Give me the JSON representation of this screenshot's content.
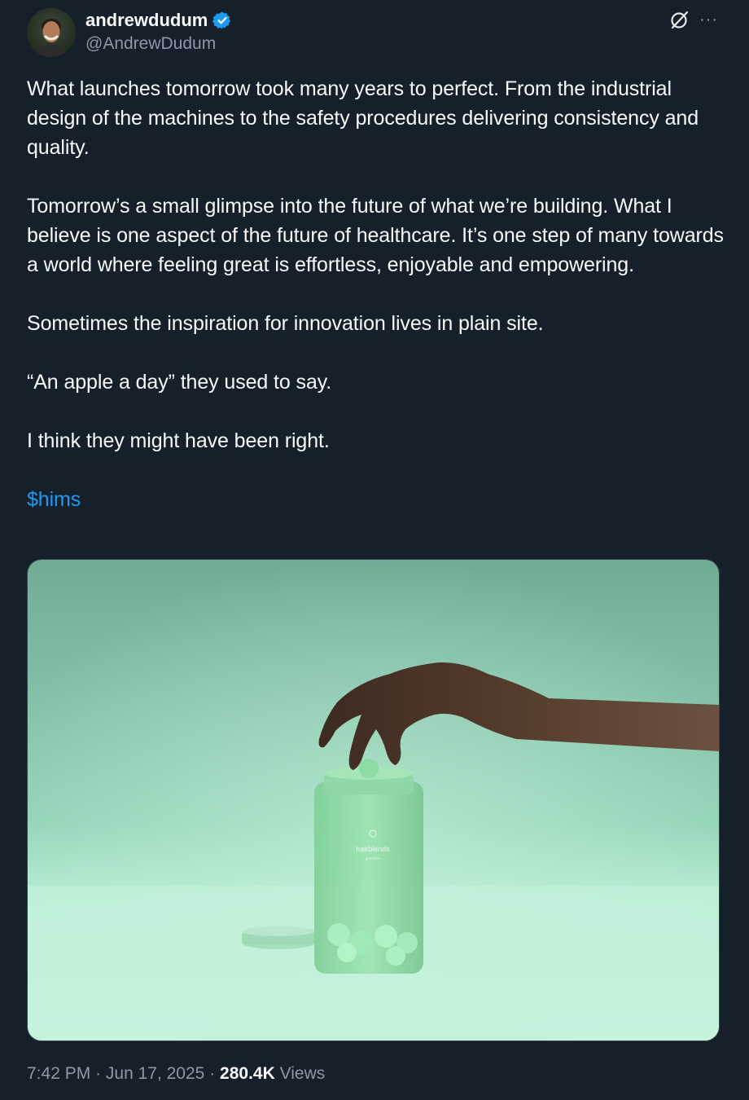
{
  "author": {
    "display_name": "andrewdudum",
    "handle": "@AndrewDudum",
    "verified": true,
    "avatar_icon": "profile-photo"
  },
  "actions": {
    "grok_icon": "grok-icon",
    "more_label": "···"
  },
  "tweet": {
    "paragraphs": [
      "What launches tomorrow took many years to perfect. From the industrial design of the machines to the safety procedures delivering consistency and quality.",
      "Tomorrow’s a small glimpse into the future of what we’re building. What I believe is one aspect of the future of healthcare. It’s one step of many towards a world where feeling great is effortless, enjoyable and empowering.",
      "Sometimes the inspiration for innovation lives in plain site.",
      "“An apple a day” they used to say.",
      "I think they might have been right."
    ],
    "cashtag": "$hims"
  },
  "media": {
    "jar_brand": "hairblends",
    "jar_subtext": "gummies"
  },
  "meta": {
    "time": "7:42 PM",
    "separator": "·",
    "date": "Jun 17, 2025",
    "views_count": "280.4K",
    "views_label": "Views"
  },
  "colors": {
    "background": "#15202b",
    "text": "#f7f9f9",
    "secondary": "#8b98a5",
    "accent": "#1d9bf0",
    "border": "#38444d"
  }
}
